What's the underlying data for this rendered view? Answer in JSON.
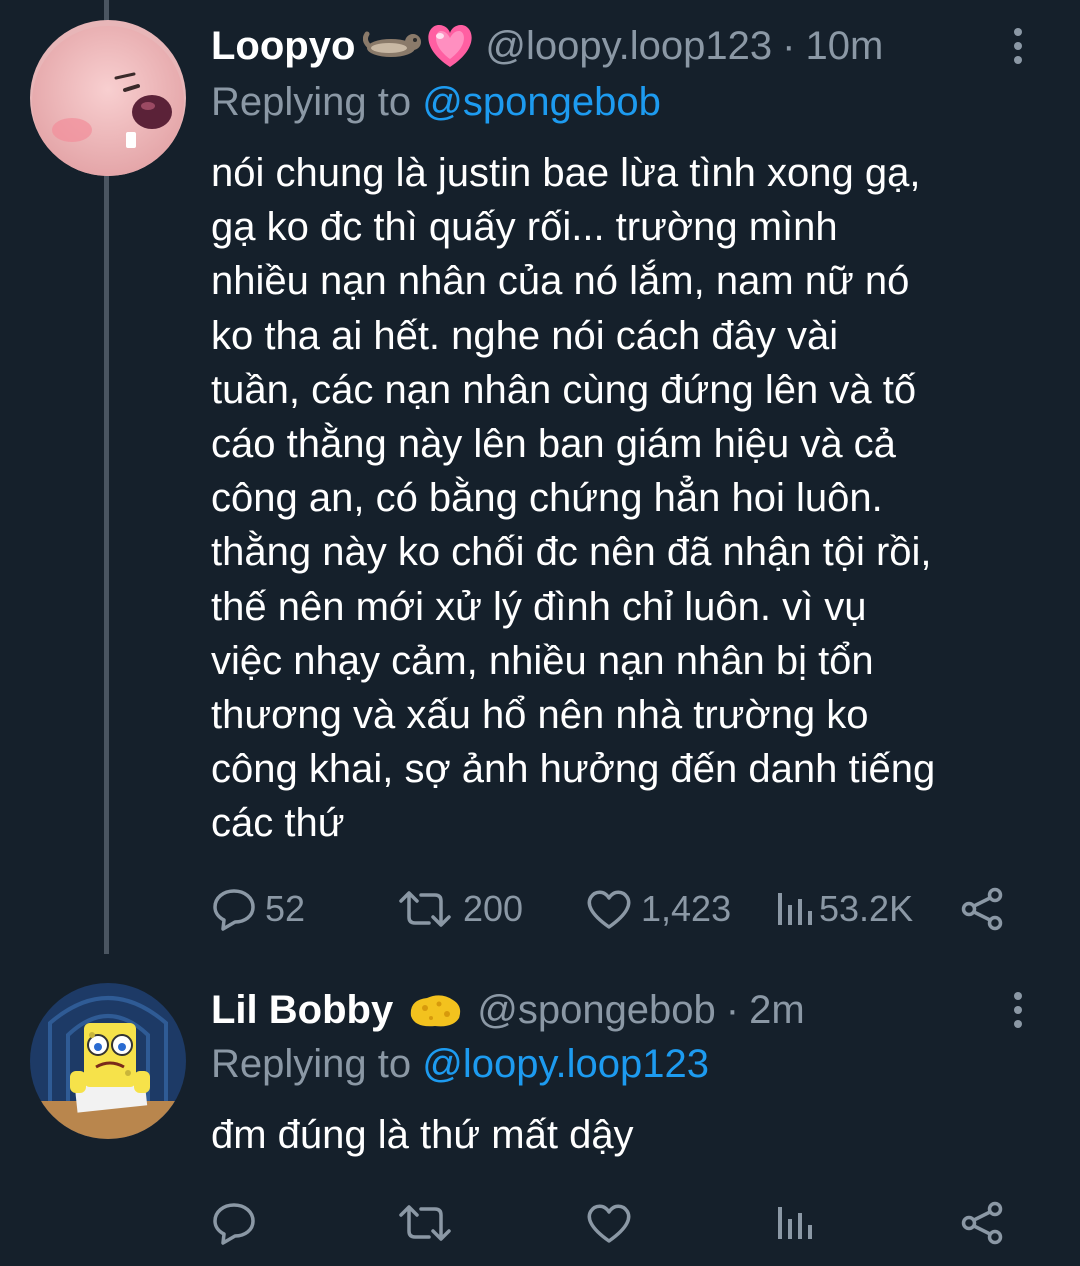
{
  "tweets": [
    {
      "name": "Loopyo",
      "handle": "@loopy.loop123",
      "separator": "·",
      "time": "10m",
      "replying_prefix": "Replying to ",
      "replying_to": "@spongebob",
      "text": "nói chung là justin bae lừa tình xong gạ,\ngạ ko đc thì quấy rối... trường mình\nnhiều nạn nhân của nó lắm, nam nữ nó\nko tha ai hết. nghe nói cách đây vài\ntuần, các nạn nhân cùng đứng lên và tố\ncáo thằng này lên ban giám hiệu và cả\ncông an, có bằng chứng hẳn hoi luôn.\nthằng này ko chối đc nên đã nhận tội rồi,\nthế nên mới xử lý đình chỉ luôn. vì vụ\nviệc nhạy cảm, nhiều nạn nhân bị tổn\nthương và xấu hổ nên nhà trường ko\ncông khai, sợ ảnh hưởng đến danh tiếng\ncác thứ",
      "emoji_icons": [
        "otter-icon",
        "pink-heart-icon"
      ],
      "stats": {
        "replies": "52",
        "retweets": "200",
        "likes": "1,423",
        "views": "53.2K"
      }
    },
    {
      "name": "Lil Bobby",
      "handle": "@spongebob",
      "separator": "·",
      "time": "2m",
      "replying_prefix": "Replying to ",
      "replying_to": "@loopy.loop123",
      "text": "đm đúng là thứ mất dậy",
      "emoji_icons": [
        "sponge-icon"
      ],
      "stats": {
        "replies": "",
        "retweets": "",
        "likes": "",
        "views": ""
      }
    }
  ],
  "colors": {
    "background": "#15202b",
    "muted": "#8b98a5",
    "link": "#1d9bf0",
    "thread_line": "#4a5561"
  }
}
